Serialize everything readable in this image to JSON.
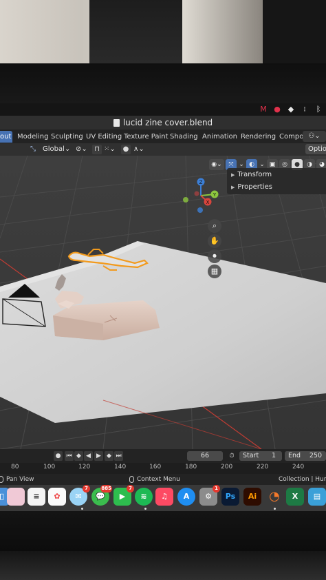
{
  "window": {
    "title": "lucid zine cover.blend"
  },
  "workspaces": {
    "tabs": [
      {
        "label": "out",
        "active": true
      },
      {
        "label": "Modeling",
        "active": false
      },
      {
        "label": "Sculpting",
        "active": false
      },
      {
        "label": "UV Editing",
        "active": false
      },
      {
        "label": "Texture Paint",
        "active": false
      },
      {
        "label": "Shading",
        "active": false
      },
      {
        "label": "Animation",
        "active": false
      },
      {
        "label": "Rendering",
        "active": false
      },
      {
        "label": "Compo",
        "active": false
      }
    ]
  },
  "header": {
    "orientation_value": "Global",
    "options_label": "Option"
  },
  "sidebar_panel": {
    "transform_label": "Transform",
    "properties_label": "Properties"
  },
  "gizmo": {
    "x_label": "X",
    "y_label": "Y",
    "z_label": "Z"
  },
  "timeline": {
    "current_frame": "66",
    "start_label": "Start",
    "start_value": "1",
    "end_label": "End",
    "end_value": "250",
    "ruler_ticks": [
      "80",
      "100",
      "120",
      "140",
      "160",
      "180",
      "200",
      "220",
      "240"
    ]
  },
  "statusbar": {
    "left_label": "Pan View",
    "center_label": "Context Menu",
    "right_label": "Collection | Huma"
  },
  "dock": {
    "badges": {
      "mail": "7",
      "messages": "885",
      "facetime": "7",
      "settings": "1"
    },
    "labels": {
      "photoshop": "Ps",
      "illustrator": "Ai",
      "excel": "X"
    }
  },
  "colors": {
    "accent": "#4772b3",
    "selection_outline": "#f29a1d",
    "axis_x": "#d8453d",
    "axis_y": "#8cc63f",
    "axis_z": "#3c7fd6"
  }
}
